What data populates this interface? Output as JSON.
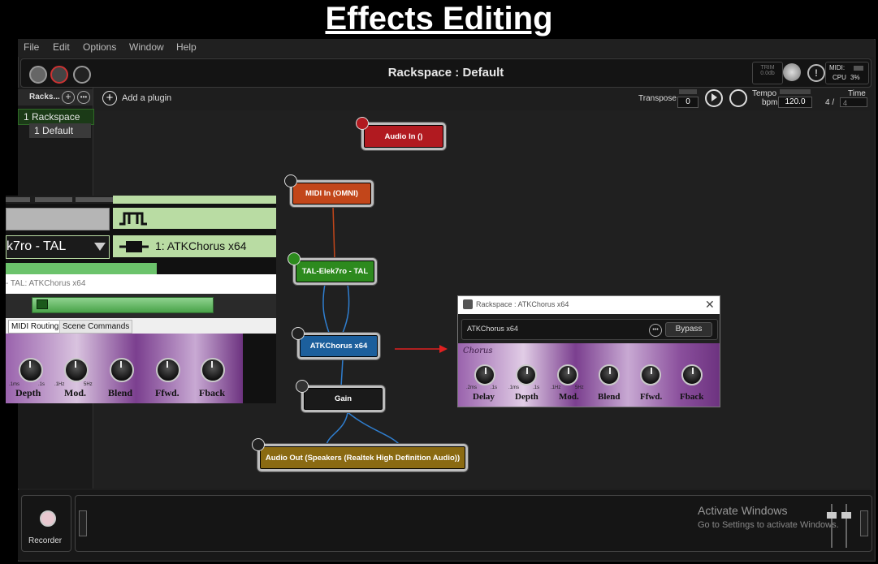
{
  "caption": "Effects Editing",
  "menu": [
    "File",
    "Edit",
    "Options",
    "Window",
    "Help"
  ],
  "topbar": {
    "title": "Rackspace : Default",
    "trim_label": "TRIM",
    "trim_value": "0.0db",
    "midi_label": "MIDI:",
    "cpu_label": "CPU",
    "cpu_value": "3%"
  },
  "side": {
    "header": "Racks...",
    "items": [
      "1 Rackspace",
      "1  Default"
    ]
  },
  "toolbar": {
    "add_plugin": "Add a plugin",
    "transpose_label": "Transpose",
    "transpose_value": "0",
    "tempo_label": "Tempo",
    "bpm_label": "bpm",
    "bpm_value": "120.0",
    "time_label": "Time",
    "time_num": "4 /",
    "time_den": "4"
  },
  "nodes": {
    "audio_in": "Audio In ()",
    "midi_in": "MIDI In (OMNI)",
    "tal": "TAL-Elek7ro - TAL",
    "atk": "ATKChorus x64",
    "gain": "Gain",
    "audio_out": "Audio Out (Speakers (Realtek High Definition Audio))"
  },
  "overlay": {
    "dropdown": "k7ro - TAL",
    "chain_item": "1:  ATKChorus x64",
    "window_title": "- TAL: ATKChorus x64",
    "tabs": [
      "MIDI Routing",
      "Scene Commands"
    ],
    "knobs": [
      "Depth",
      "Mod.",
      "Blend",
      "Ffwd.",
      "Fback"
    ],
    "ticks": [
      ".1ms",
      ".1s",
      ".1Hz",
      "5Hz"
    ]
  },
  "dialog": {
    "title": "Rackspace : ATKChorus x64",
    "plugin_name": "ATKChorus x64",
    "bypass": "Bypass",
    "brand": "Chorus",
    "knobs": [
      "Delay",
      "Depth",
      "Mod.",
      "Blend",
      "Ffwd.",
      "Fback"
    ],
    "ticks": [
      ".2ms",
      ".1s",
      ".1ms",
      ".1s",
      ".1Hz",
      "5Hz"
    ]
  },
  "bottom": {
    "recorder": "Recorder",
    "activate_title": "Activate Windows",
    "activate_sub": "Go to Settings to activate Windows."
  },
  "colors": {
    "audio_in": "#b11a20",
    "midi_in": "#c2461a",
    "tal": "#2d8a1e",
    "atk": "#1c5f9c",
    "gain": "#1a1a1a",
    "audio_out": "#8a6a12",
    "panel_green": "#b9dca3",
    "purple": "#7b3f8f"
  }
}
